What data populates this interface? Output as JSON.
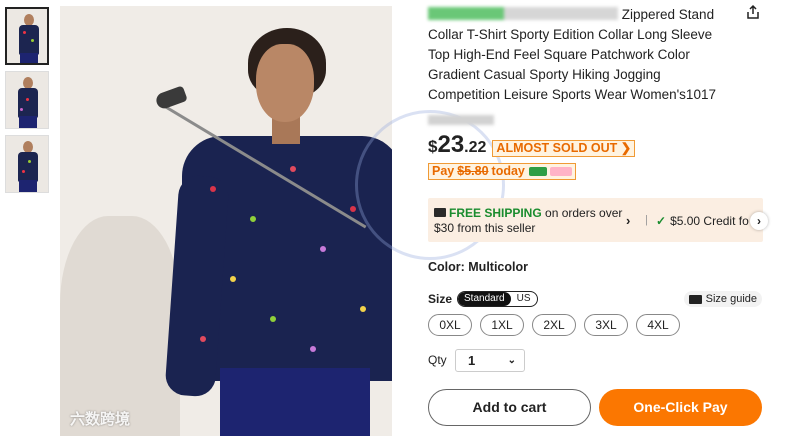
{
  "product": {
    "title_suffix": "Zippered Stand Collar T-Shirt Sporty Edition Collar Long Sleeve Top High-End Feel Square Patchwork Color Gradient Casual Sporty Hiking Jogging Competition Leisure Sports Wear Women's1017",
    "share_icon": "share-icon"
  },
  "price": {
    "currency": "$",
    "integer": "23",
    "decimal": ".22",
    "badge": "ALMOST SOLD OUT",
    "pay_prefix": "Pay",
    "pay_amount": "$5.80",
    "pay_suffix": "today",
    "accent_color": "#e86a00"
  },
  "shipping": {
    "free_label": "FREE SHIPPING",
    "detail": "on orders over $30 from this seller",
    "credit": "$5.00 Credit fo"
  },
  "color": {
    "label": "Color: Multicolor"
  },
  "size": {
    "label": "Size",
    "toggle_on": "Standard",
    "toggle_off": "US",
    "guide": "Size guide",
    "options": [
      "0XL",
      "1XL",
      "2XL",
      "3XL",
      "4XL"
    ]
  },
  "qty": {
    "label": "Qty",
    "value": "1"
  },
  "actions": {
    "add_to_cart": "Add to cart",
    "one_click": "One-Click Pay",
    "brand_color": "#fb7701"
  },
  "watermark": "六数跨境"
}
